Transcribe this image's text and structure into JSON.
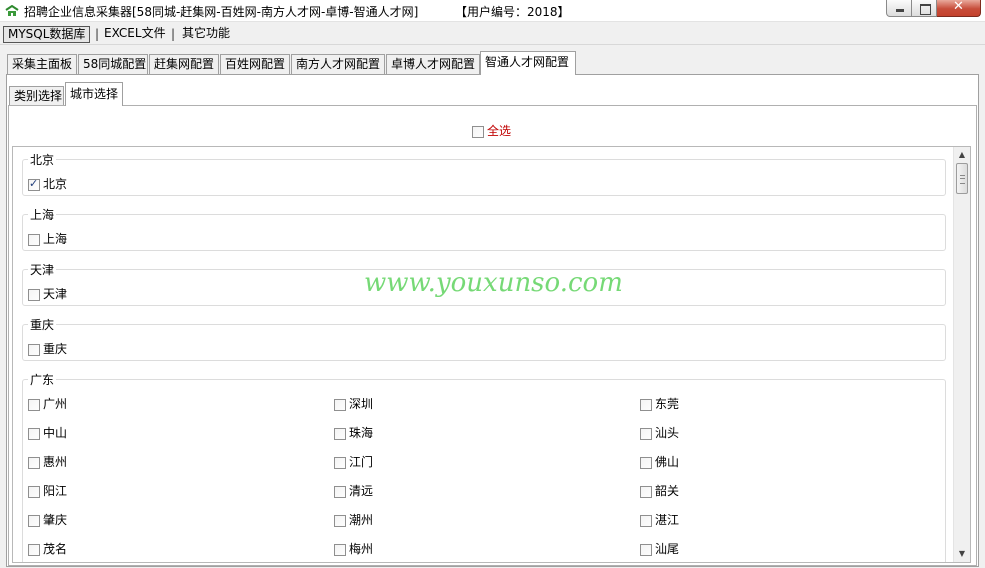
{
  "window": {
    "title": "招聘企业信息采集器[58同城-赶集网-百姓网-南方人才网-卓博-智通人才网]",
    "user_label": "【用户编号：2018】"
  },
  "menubar": {
    "items": [
      "MYSQL数据库",
      "EXCEL文件",
      "其它功能"
    ]
  },
  "main_tabs": [
    "采集主面板",
    "58同城配置",
    "赶集网配置",
    "百姓网配置",
    "南方人才网配置",
    "卓博人才网配置",
    "智通人才网配置"
  ],
  "sub_tabs": [
    "类别选择",
    "城市选择"
  ],
  "select_all": {
    "label": "全选",
    "checked": false
  },
  "groups": [
    {
      "name": "北京",
      "cities": [
        {
          "name": "北京",
          "checked": true
        }
      ]
    },
    {
      "name": "上海",
      "cities": [
        {
          "name": "上海",
          "checked": false
        }
      ]
    },
    {
      "name": "天津",
      "cities": [
        {
          "name": "天津",
          "checked": false
        }
      ]
    },
    {
      "name": "重庆",
      "cities": [
        {
          "name": "重庆",
          "checked": false
        }
      ]
    },
    {
      "name": "广东",
      "cities": [
        {
          "name": "广州",
          "checked": false
        },
        {
          "name": "深圳",
          "checked": false
        },
        {
          "name": "东莞",
          "checked": false
        },
        {
          "name": "中山",
          "checked": false
        },
        {
          "name": "珠海",
          "checked": false
        },
        {
          "name": "汕头",
          "checked": false
        },
        {
          "name": "惠州",
          "checked": false
        },
        {
          "name": "江门",
          "checked": false
        },
        {
          "name": "佛山",
          "checked": false
        },
        {
          "name": "阳江",
          "checked": false
        },
        {
          "name": "清远",
          "checked": false
        },
        {
          "name": "韶关",
          "checked": false
        },
        {
          "name": "肇庆",
          "checked": false
        },
        {
          "name": "潮州",
          "checked": false
        },
        {
          "name": "湛江",
          "checked": false
        },
        {
          "name": "茂名",
          "checked": false
        },
        {
          "name": "梅州",
          "checked": false
        },
        {
          "name": "汕尾",
          "checked": false
        }
      ]
    }
  ],
  "watermark": "www.youxunso.com"
}
